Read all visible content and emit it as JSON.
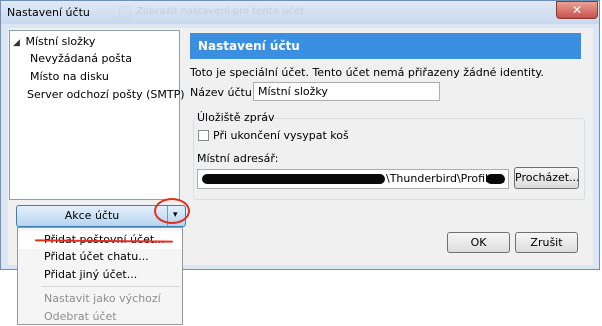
{
  "window": {
    "title": "Nastavení účtu",
    "ghost_title": "Zobrazit nastavení pro tento účet",
    "close_label": "✕"
  },
  "tree": {
    "root_label": "Místní složky",
    "children": [
      "Nevyžádaná pošta",
      "Místo na disku"
    ],
    "server_label": "Server odchozí pošty (SMTP)"
  },
  "actions": {
    "button_label": "Akce účtu",
    "dropdown_glyph": "▾",
    "menu": [
      {
        "label": "Přidat poštovní účet...",
        "enabled": true
      },
      {
        "label": "Přidat účet chatu...",
        "enabled": true
      },
      {
        "label": "Přidat jiný účet...",
        "enabled": true
      },
      {
        "label": "Nastavit jako výchozí",
        "enabled": false
      },
      {
        "label": "Odebrat účet",
        "enabled": false
      }
    ]
  },
  "panel": {
    "header": "Nastavení účtu",
    "info": "Toto je speciální účet. Tento účet nemá přiřazeny žádné identity.",
    "name_label": "Název účtu:",
    "name_value": "Místní složky",
    "storage_section": "Úložiště zpráv",
    "empty_trash_label": "Při ukončení vysypat koš",
    "empty_trash_checked": false,
    "local_dir_label": "Místní adresář:",
    "local_dir_value": "\\Thunderbird\\Profiles\\",
    "browse_label": "Procházet..."
  },
  "footer": {
    "ok_label": "OK",
    "cancel_label": "Zrušit"
  },
  "colors": {
    "header_bg": "#3b8fe1",
    "annotation": "#e0301e",
    "close_bg": "#c75050"
  }
}
